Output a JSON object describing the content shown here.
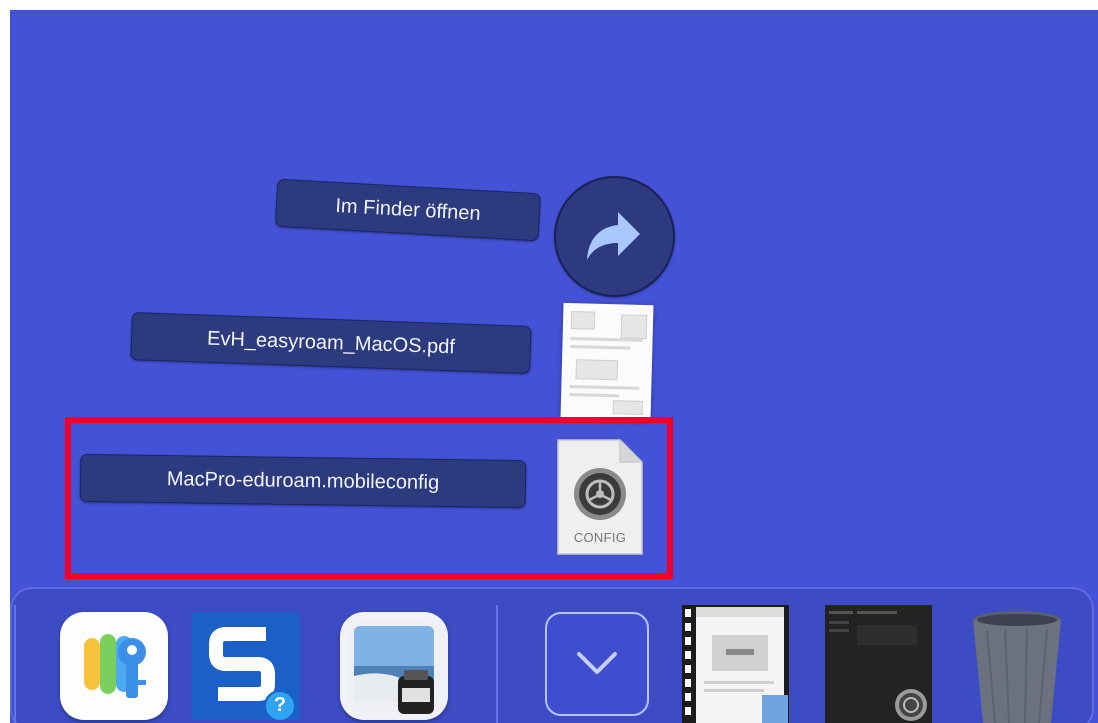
{
  "stack": {
    "open_in_finder_label": "Im Finder öffnen",
    "items": [
      {
        "label": "EvH_easyroam_MacOS.pdf"
      },
      {
        "label": "MacPro-eduroam.mobileconfig",
        "file_type_label": "CONFIG"
      }
    ]
  },
  "dock": {
    "apps": [
      {
        "icon": "passwords-app-icon"
      },
      {
        "icon": "snagit-app-icon",
        "badge": "?"
      },
      {
        "icon": "preview-app-icon"
      }
    ],
    "downloads_icon": "chevron-down-icon",
    "trash_icon": "trash-icon"
  },
  "colors": {
    "desktop": "#4352d6",
    "label_bg": "#2c3a7e",
    "highlight": "#f2002a",
    "dock_bg": "#3d4cc4"
  }
}
